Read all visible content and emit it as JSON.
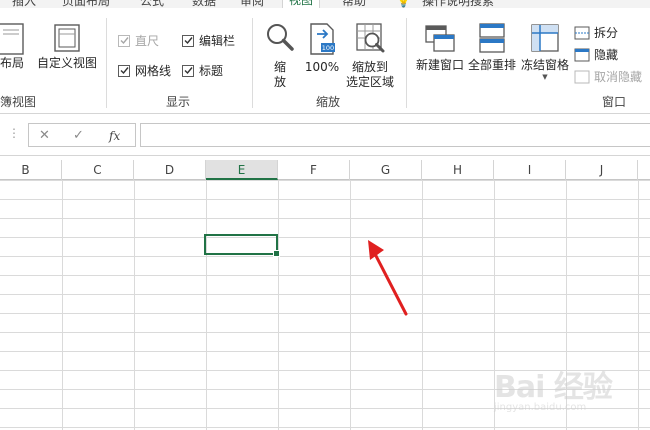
{
  "tabs": [
    "插入",
    "页面布局",
    "公式",
    "数据",
    "审阅",
    "视图",
    "帮助",
    "操作说明搜索"
  ],
  "active_tab": "视图",
  "ribbon": {
    "workbook_views": {
      "group_label": "簿视图",
      "page_layout_label": "页面布局",
      "custom_views_label": "自定义视图"
    },
    "show": {
      "group_label": "显示",
      "ruler_label": "直尺",
      "formula_bar_label": "编辑栏",
      "gridlines_label": "网格线",
      "headings_label": "标题"
    },
    "zoom": {
      "group_label": "缩放",
      "zoom_label_line1": "缩",
      "zoom_label_line2": "放",
      "zoom100_label": "100%",
      "zoom100_icon_text": "100",
      "zoom_selection_line1": "缩放到",
      "zoom_selection_line2": "选定区域"
    },
    "window": {
      "group_label": "窗口",
      "new_window_label": "新建窗口",
      "arrange_all_label": "全部重排",
      "freeze_panes_label": "冻结窗格",
      "split_label": "拆分",
      "hide_label": "隐藏",
      "unhide_label": "取消隐藏"
    }
  },
  "formula_bar": {
    "cancel_glyph": "✕",
    "enter_glyph": "✓",
    "fx_label": "fx",
    "value": ""
  },
  "columns": [
    "B",
    "C",
    "D",
    "E",
    "F",
    "G",
    "H",
    "I",
    "J"
  ],
  "selected_column": "E",
  "watermark": {
    "line1": "Bai 经验",
    "line2": "jingyan.baidu.com"
  },
  "colors": {
    "accent": "#217346",
    "arrow": "#e02020",
    "gridline": "#dadada"
  }
}
